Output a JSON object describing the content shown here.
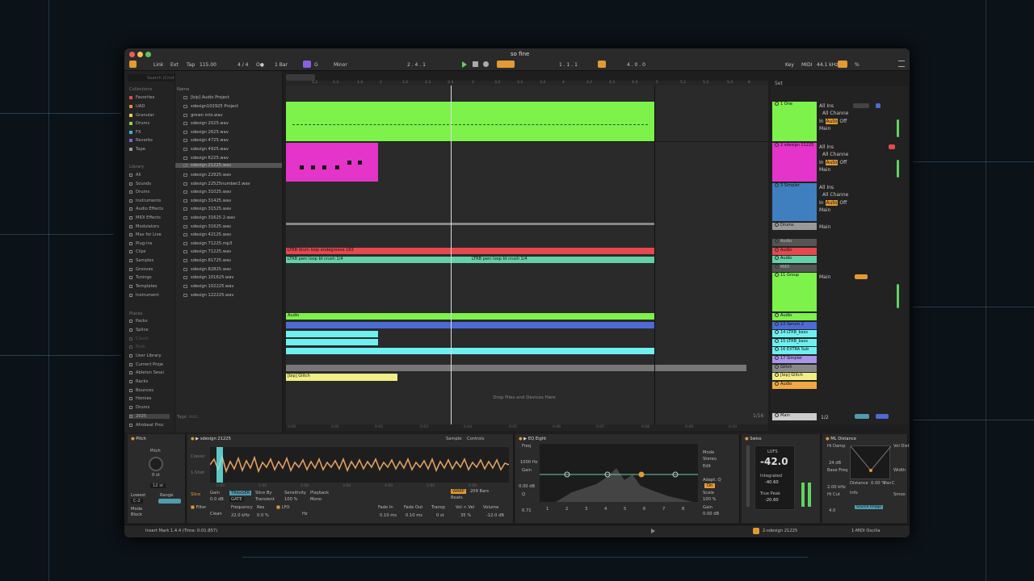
{
  "window": {
    "title": "so fine"
  },
  "transport": {
    "link": "Link",
    "ext": "Ext",
    "tap": "Tap",
    "tempo": "115.00",
    "time_sig": "4 / 4",
    "metro": "O●",
    "quantize": "1 Bar",
    "key": "G",
    "scale": "Minor",
    "position": "2 . 4 . 1",
    "loop_start": "1 . 1 . 1",
    "loop_len": "4 . 0 . 0",
    "key_btn": "Key",
    "midi": "MIDI",
    "sample_rate": "44.1 kHz",
    "cpu": "%"
  },
  "browser": {
    "search_placeholder": "Search (Cmd + F)",
    "collections_header": "Collections",
    "collections": [
      {
        "label": "Favorites",
        "color": "#e5484d"
      },
      {
        "label": "UAD",
        "color": "#e88b3a"
      },
      {
        "label": "Granular",
        "color": "#e5d34a"
      },
      {
        "label": "Drums",
        "color": "#8fd14f"
      },
      {
        "label": "FX",
        "color": "#38b6c9"
      },
      {
        "label": "Reverbs",
        "color": "#7b63d6"
      },
      {
        "label": "Tape",
        "color": "#999999"
      }
    ],
    "library_header": "Library",
    "library": [
      "All",
      "Sounds",
      "Drums",
      "Instruments",
      "Audio Effects",
      "MIDI Effects",
      "Modulators",
      "Max for Live",
      "Plug-ins",
      "Clips",
      "Samples",
      "Grooves",
      "Tunings",
      "Templates",
      "Instrument"
    ],
    "places_header": "Places",
    "places": [
      "Packs",
      "Splice",
      "Cloud",
      "Push",
      "User Library",
      "Current Proje",
      "Ableton Sessi",
      "Racks",
      "Bounces",
      "Homies",
      "Drums",
      "2025",
      "Afrobeat Proc"
    ],
    "name_header": "Name",
    "files": [
      "[bip] Audio Project",
      "sdesign102925 Project",
      "grown into.wav",
      "sdesign 2025.wav",
      "sdesign 2625.wav",
      "sdesign 4725.wav",
      "sdesign 4925.wav",
      "sdesign 6225.wav",
      "sdesign 21225.wav",
      "sdesign 22925.wav",
      "sdesign 22525number2.wav",
      "sdesign 31025.wav",
      "sdesign 31425.wav",
      "sdesign 31525.wav",
      "sdesign 31625 2.wav",
      "sdesign 31625.wav",
      "sdesign 42125.wav",
      "sdesign 71225.mp3",
      "sdesign 71225.wav",
      "sdesign 81725.wav",
      "sdesign 82825.wav",
      "sdesign 101625.wav",
      "sdesign 102225.wav",
      "sdesign 122225.wav"
    ],
    "tags_label": "Tags",
    "tags_value": "Add..."
  },
  "arrangement": {
    "ruler": [
      "1",
      "1.2",
      "1.3",
      "1.4",
      "2",
      "2.2",
      "2.3",
      "2.4",
      "3",
      "3.2",
      "3.3",
      "3.4",
      "4",
      "4.2",
      "4.3",
      "4.4",
      "5",
      "5.2",
      "5.3",
      "5.4",
      "6"
    ],
    "time_ruler": [
      "0:00",
      "0:01",
      "0:02",
      "0:03",
      "0:04",
      "0:05",
      "0:06",
      "0:07",
      "0:08",
      "0:09",
      "0:10"
    ],
    "clip_drum": "LTRB drum loop endegroove 163",
    "clip_perc1": "LTRB perc loop bt crush 1/4",
    "clip_perc2": "LTRB perc loop bt crush 1/4",
    "clip_audio": "Audio",
    "clip_glitch": "[bip] Glitch",
    "drop_text": "Drop Files and Devices Here",
    "zoom": "1/16"
  },
  "mixer": {
    "set_label": "Set",
    "tracks": [
      {
        "name": "1 One",
        "color": "#7cf24b",
        "input": "All Ins",
        "channel": "All Channe"
      },
      {
        "name": "2 sdesign 21225",
        "color": "#e534c9",
        "input": "All Ins",
        "channel": "All Channe"
      },
      {
        "name": "3 Simpler",
        "color": "#3f7fc0",
        "input": "All Ins",
        "channel": "All Channe"
      },
      {
        "name": "Drums",
        "color": "#999999"
      },
      {
        "name": "Audio",
        "color": "#999999"
      },
      {
        "name": "Audio",
        "color": "#e5484d"
      },
      {
        "name": "Audio",
        "color": "#62d1a5"
      },
      {
        "name": "MIDI",
        "color": "#999999"
      },
      {
        "name": "11 Group",
        "color": "#7cf24b"
      },
      {
        "name": "Audio",
        "color": "#7cf24b"
      },
      {
        "name": "13 Serum 2",
        "color": "#4e6ad6"
      },
      {
        "name": "14 LTRB_bass",
        "color": "#6ef0f0"
      },
      {
        "name": "15 LTRB_bass",
        "color": "#6ef0f0"
      },
      {
        "name": "16 EXTRA Sub",
        "color": "#6ef0f0"
      },
      {
        "name": "17 Simpler",
        "color": "#a996e8"
      },
      {
        "name": "Glitch",
        "color": "#888888"
      },
      {
        "name": "[bip] Glitch",
        "color": "#f0ee86"
      },
      {
        "name": "Audio",
        "color": "#f0a846"
      }
    ],
    "main": "Main",
    "main_ratio": "1/2",
    "in_label": "In",
    "auto_label": "Auto",
    "off_label": "Off",
    "main_out": "Main"
  },
  "devices": {
    "pitch": {
      "title": "Pitch",
      "pitch_label": "Pitch",
      "pitch_val": "0 st",
      "range_val": "12 st",
      "lowest_label": "Lowest",
      "range_label": "Range",
      "lowest_val": "C-2",
      "mode_label": "Mode",
      "mode_val": "Block"
    },
    "sample": {
      "title": "sdesign 21225",
      "sample_tab": "Sample",
      "controls_tab": "Controls",
      "classic": "Classic",
      "oneshot": "1-Shot",
      "slice": "Slice",
      "gain_label": "Gain",
      "gain_val": "0.0 dB",
      "trigger": "TRIGGER",
      "gate": "GATE",
      "slice_by": "Slice By",
      "slice_by_val": "Transient",
      "sensitivity": "Sensitivity",
      "sensitivity_val": "100 %",
      "playback": "Playback",
      "playback_val": "Mono",
      "warp": "WARP",
      "bars_val": "209 Bars",
      "beats": "Beats",
      "filter": "Filter",
      "freq_label": "Frequency",
      "freq_val": "22.0 kHz",
      "res_label": "Res",
      "res_val": "0.0 %",
      "clean": "Clean",
      "lfo": "LFO",
      "hz": "Hz",
      "fadein": "Fade In",
      "fadein_val": "0.10 ms",
      "fadeout": "Fade Out",
      "fadeout_val": "0.10 ms",
      "transp": "Transp",
      "transp_val": "0 st",
      "volvel": "Vol < Vel",
      "volvel_val": "35 %",
      "volume": "Volume",
      "volume_val": "-12.0 dB",
      "wave_times": [
        "0:00",
        "1:00",
        "2:00",
        "3:00",
        "4:00",
        "5:00",
        "6:00",
        "7:00"
      ]
    },
    "eq": {
      "title": "EQ Eight",
      "freq": "Freq",
      "freq_val": "1000 Hz",
      "gain": "Gain",
      "gain_val": "0.00 dB",
      "q": "Q",
      "q_val": "0.71",
      "mode": "Mode",
      "mode_val": "Stereo",
      "edit": "Edit",
      "adapt": "Adapt. Q",
      "on": "On",
      "scale": "Scale",
      "scale_val": "100 %",
      "out_gain": "Gain",
      "out_gain_val": "0.00 dB",
      "bands": [
        "1",
        "2",
        "3",
        "4",
        "5",
        "6",
        "7",
        "8"
      ]
    },
    "swiss": {
      "title": "Swiss",
      "lufs": "LUFS",
      "lufs_val": "-42.0",
      "integrated": "Integrated",
      "integrated_val": "-40.60",
      "truepeak": "True Peak",
      "truepeak_val": "-20.60"
    },
    "ml": {
      "title": "ML Distance",
      "hi_damp": "Hi Damp",
      "hi_damp_val": "24 dB",
      "base_freq": "Base Freq",
      "base_freq_val": "2.00 kHz",
      "hi_cut": "Hi Cut",
      "hi_cut_val": "4.0",
      "distance": "Distance",
      "distance_val": "0.00 %",
      "pan": "Pan",
      "pan_val": "C",
      "info": "Info",
      "source_img": "Source Image",
      "vol_dist": "Vol Dist",
      "width": "Width",
      "smooth": "Smoo"
    }
  },
  "status": {
    "text": "Insert Mark 1.4.4 (Time: 0:01:857)",
    "clip_name": "2-sdesign 21225",
    "right": "1-MIDI Oscilla"
  }
}
